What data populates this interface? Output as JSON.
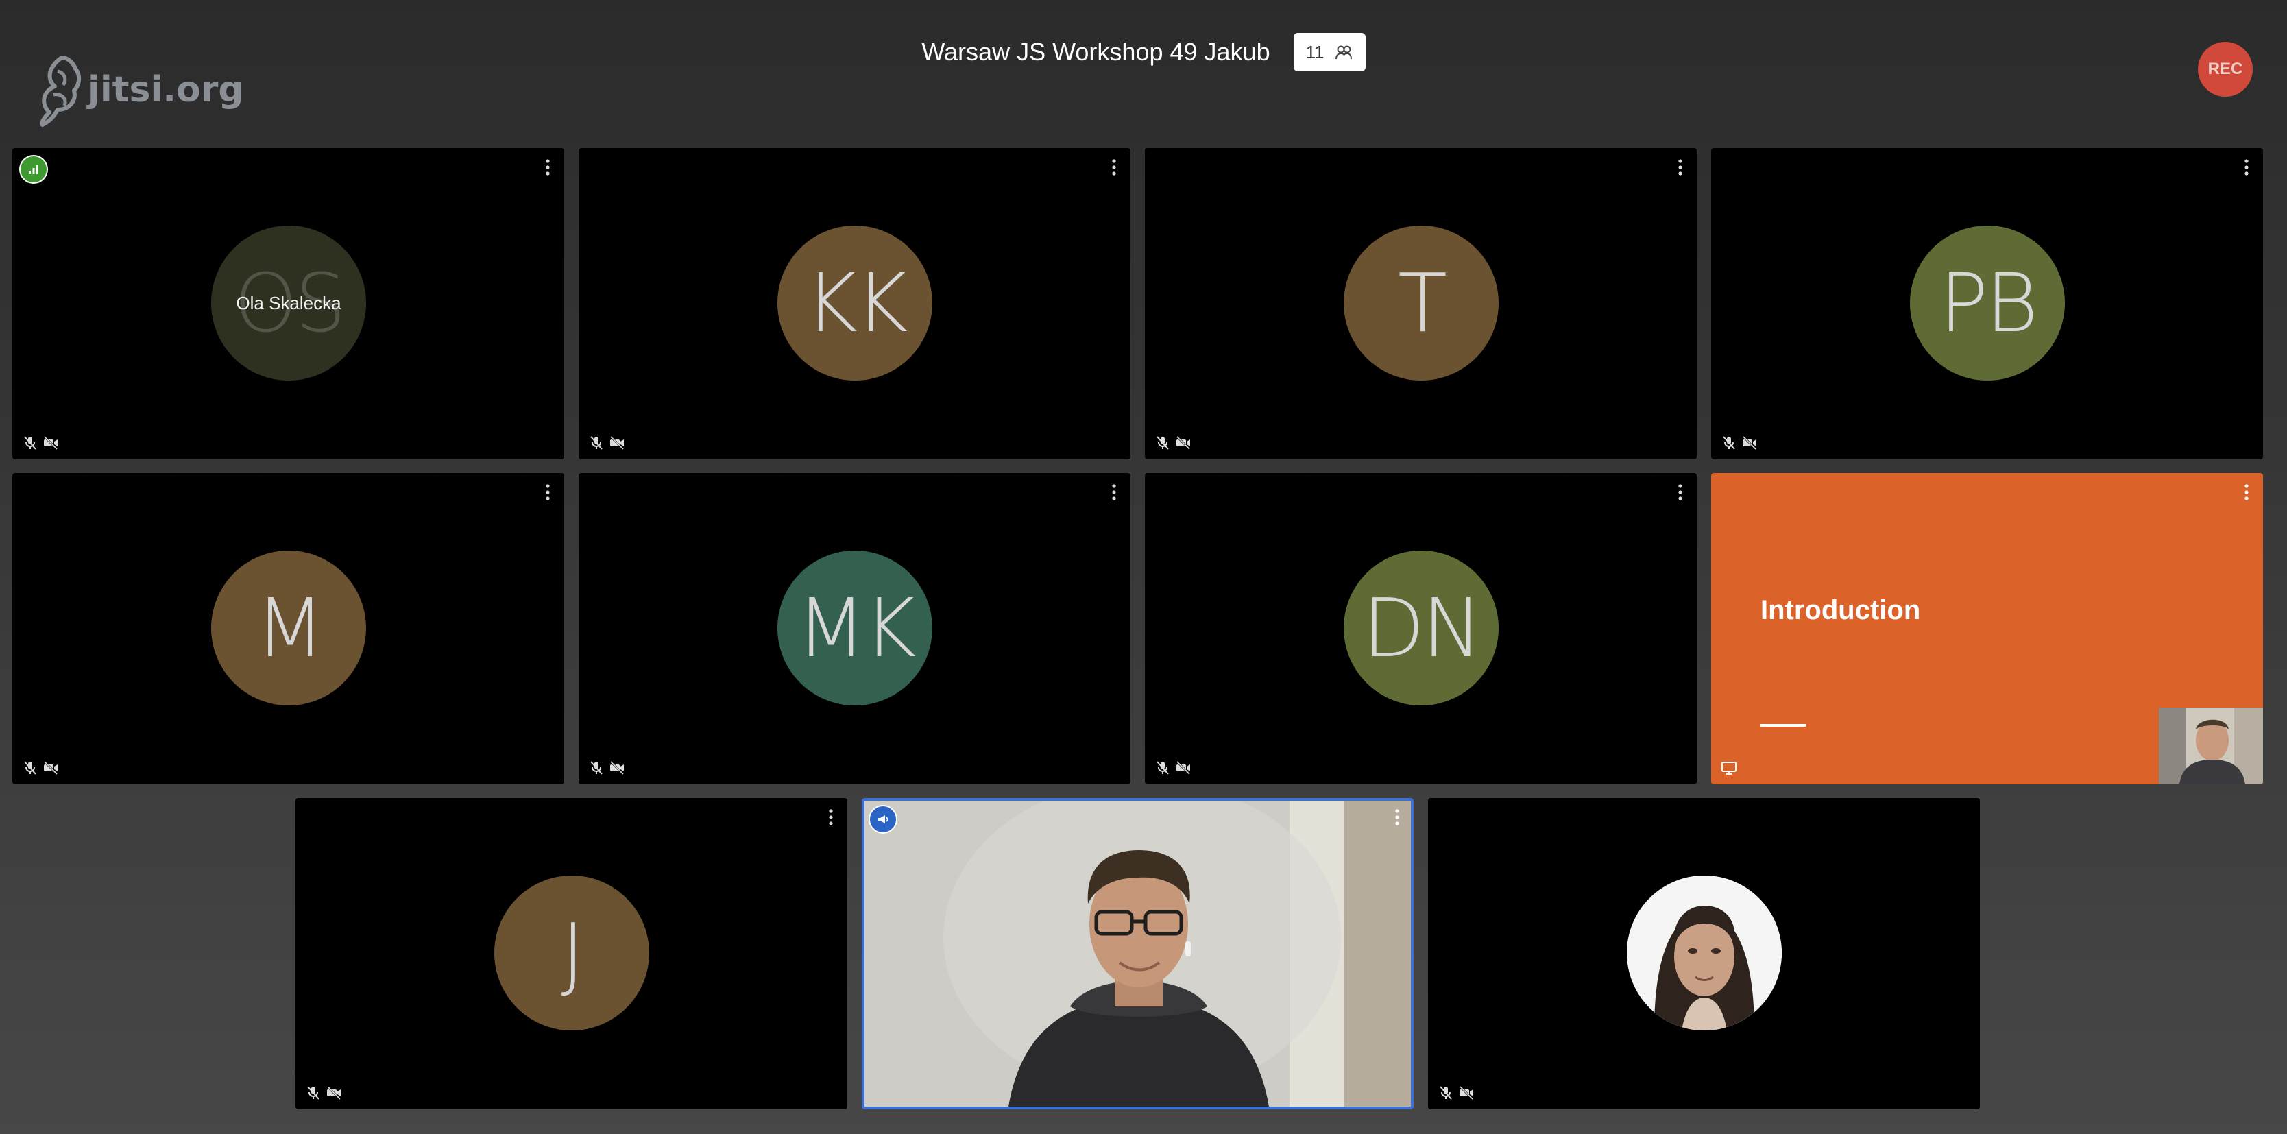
{
  "logo": {
    "text": "jitsi.org"
  },
  "header": {
    "title": "Warsaw JS Workshop 49 Jakub",
    "participant_count": "11"
  },
  "recording": {
    "label": "REC",
    "color": "#d1493a"
  },
  "tiles": [
    {
      "initials": "OS",
      "name": "Ola Skalecka",
      "avatar_color": "#2f3120"
    },
    {
      "initials": "KK",
      "avatar_color": "#6b5230"
    },
    {
      "initials": "T",
      "avatar_color": "#6b5230"
    },
    {
      "initials": "PB",
      "avatar_color": "#5e6b35"
    },
    {
      "initials": "M",
      "avatar_color": "#6b5230"
    },
    {
      "initials": "MK",
      "avatar_color": "#34604f"
    },
    {
      "initials": "DN",
      "avatar_color": "#5e6b35"
    },
    {
      "initials": "J",
      "avatar_color": "#6b5230"
    }
  ],
  "presentation": {
    "slide_title": "Introduction",
    "background": "#db6229"
  },
  "active_speaker": {
    "border_color": "#3d6fd1"
  }
}
